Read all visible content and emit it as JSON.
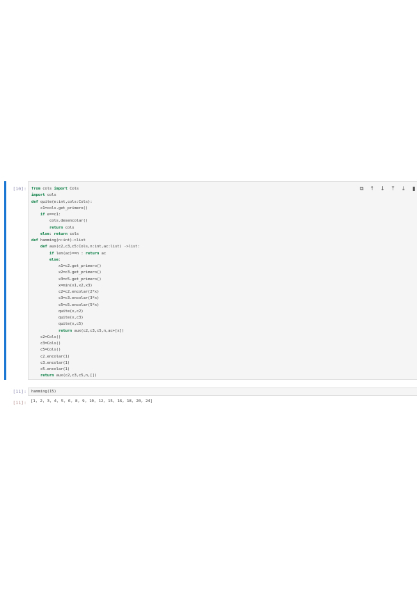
{
  "cells": [
    {
      "prompt": "[10]:",
      "lines": [
        [
          {
            "t": "from",
            "kw": true
          },
          {
            "t": " cols "
          },
          {
            "t": "import",
            "kw": true
          },
          {
            "t": " Cols"
          }
        ],
        [
          {
            "t": "import",
            "kw": true
          },
          {
            "t": " cols"
          }
        ],
        [
          {
            "t": "def",
            "kw": true
          },
          {
            "t": " quite(e:int,cols:Cols):"
          }
        ],
        [
          {
            "t": "    c1=cols.get_primero()"
          }
        ],
        [
          {
            "t": "    "
          },
          {
            "t": "if",
            "kw": true
          },
          {
            "t": " e==c1:"
          }
        ],
        [
          {
            "t": "        cols.desencolar()"
          }
        ],
        [
          {
            "t": "        "
          },
          {
            "t": "return",
            "kw": true
          },
          {
            "t": " cols"
          }
        ],
        [
          {
            "t": "    "
          },
          {
            "t": "else",
            "kw": true
          },
          {
            "t": ": "
          },
          {
            "t": "return",
            "kw": true
          },
          {
            "t": " cols"
          }
        ],
        [
          {
            "t": "def",
            "kw": true
          },
          {
            "t": " hamming(n:int)->list"
          }
        ],
        [
          {
            "t": "    "
          },
          {
            "t": "def",
            "kw": true
          },
          {
            "t": " aux(c2,c3,c5:Cols,n:int,ac:list) ->list:"
          }
        ],
        [
          {
            "t": "        "
          },
          {
            "t": "if",
            "kw": true
          },
          {
            "t": " len(ac)==n : "
          },
          {
            "t": "return",
            "kw": true
          },
          {
            "t": " ac"
          }
        ],
        [
          {
            "t": "        "
          },
          {
            "t": "else",
            "kw": true
          },
          {
            "t": ":"
          }
        ],
        [
          {
            "t": "            x1=c2.get_primero()"
          }
        ],
        [
          {
            "t": "            x2=c3.get_primero()"
          }
        ],
        [
          {
            "t": "            x3=c5.get_primero()"
          }
        ],
        [
          {
            "t": "            x=min(x1,x2,x3)"
          }
        ],
        [
          {
            "t": "            c2=c2.encolar(2*x)"
          }
        ],
        [
          {
            "t": "            c3=c3.encolar(3*x)"
          }
        ],
        [
          {
            "t": "            c5=c5.encolar(5*x)"
          }
        ],
        [
          {
            "t": "            quite(x,c2)"
          }
        ],
        [
          {
            "t": "            quite(x,c3)"
          }
        ],
        [
          {
            "t": "            quite(x,c5)"
          }
        ],
        [
          {
            "t": "            "
          },
          {
            "t": "return",
            "kw": true
          },
          {
            "t": " aux(c2,c3,c5,n,ac+[x])"
          }
        ],
        [
          {
            "t": "    c2=Cols()"
          }
        ],
        [
          {
            "t": "    c3=Cols()"
          }
        ],
        [
          {
            "t": "    c5=Cols()"
          }
        ],
        [
          {
            "t": "    c2.encolar(1)"
          }
        ],
        [
          {
            "t": "    c3.encolar(1)"
          }
        ],
        [
          {
            "t": "    c5.encolar(1)"
          }
        ],
        [
          {
            "t": "    "
          },
          {
            "t": "return",
            "kw": true
          },
          {
            "t": " aux(c2,c3,c5,n,[])"
          }
        ]
      ]
    },
    {
      "prompt": "[11]:",
      "lines": [
        [
          {
            "t": "hamming(15)"
          }
        ]
      ]
    }
  ],
  "output": {
    "prompt": "[11]:",
    "text": "[1, 2, 3, 4, 5, 6, 8, 9, 10, 12, 15, 16, 18, 20, 24]"
  },
  "toolbar": {
    "icons": [
      {
        "name": "copy-icon",
        "glyph": "⧉"
      },
      {
        "name": "move-up-icon",
        "glyph": "↑"
      },
      {
        "name": "move-down-icon",
        "glyph": "↓"
      },
      {
        "name": "insert-above-icon",
        "glyph": "⤒"
      },
      {
        "name": "insert-below-icon",
        "glyph": "⤓"
      },
      {
        "name": "delete-icon",
        "glyph": "▮"
      }
    ]
  },
  "colors": {
    "active_bar": "#1976d2",
    "keyword": "#007a3d"
  }
}
